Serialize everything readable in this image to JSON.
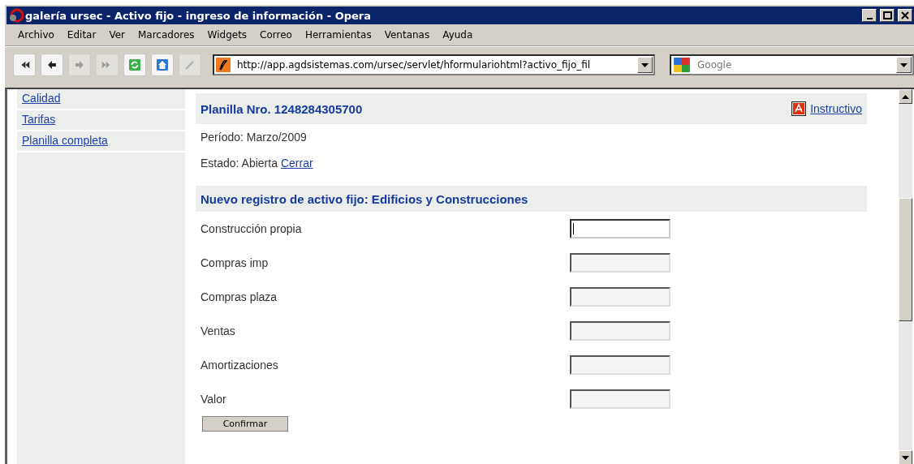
{
  "window": {
    "title": "galería ursec - Activo fijo - ingreso de información - Opera"
  },
  "menu": [
    "Archivo",
    "Editar",
    "Ver",
    "Marcadores",
    "Widgets",
    "Correo",
    "Herramientas",
    "Ventanas",
    "Ayuda"
  ],
  "toolbar": [
    {
      "kind": "rewind",
      "disabled": false
    },
    {
      "kind": "back",
      "disabled": false
    },
    {
      "kind": "forward",
      "disabled": true
    },
    {
      "kind": "fast-forward",
      "disabled": true
    },
    {
      "kind": "reload",
      "disabled": false
    },
    {
      "kind": "home",
      "disabled": false
    },
    {
      "kind": "wand",
      "disabled": true
    }
  ],
  "address": {
    "value": "http://app.agdsistemas.com/ursec/servlet/hformulariohtml?activo_fijo_fil"
  },
  "search": {
    "placeholder": "Google"
  },
  "sidebar": {
    "items": [
      "Calidad",
      "Tarifas",
      "Planilla completa"
    ]
  },
  "header": {
    "title": "Planilla Nro. 1248284305700",
    "link": "Instructivo"
  },
  "period": "Período: Marzo/2009",
  "state": {
    "text": "Estado: Abierta",
    "link": "Cerrar"
  },
  "form": {
    "title": "Nuevo registro de activo fijo: Edificios y Construcciones",
    "fields": [
      {
        "label": "Construcción propia",
        "focused": true
      },
      {
        "label": "Compras imp",
        "focused": false
      },
      {
        "label": "Compras plaza",
        "focused": false
      },
      {
        "label": "Ventas",
        "focused": false
      },
      {
        "label": "Amortizaciones",
        "focused": false
      },
      {
        "label": "Valor",
        "focused": false
      }
    ],
    "button": "Confirmar"
  }
}
